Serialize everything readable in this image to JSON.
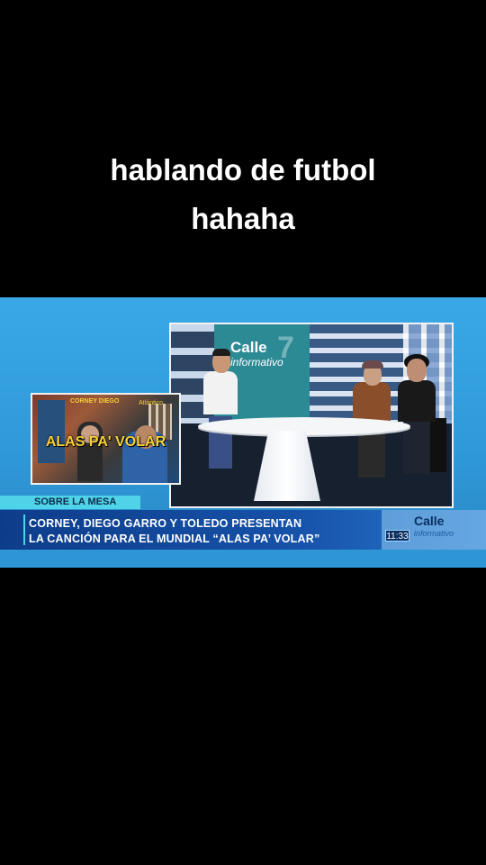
{
  "caption": {
    "line1": "hablando de futbol",
    "line2": "hahaha"
  },
  "broadcast": {
    "studio_logo": {
      "name": "Calle",
      "sub": "informativo",
      "number": "7"
    },
    "inset": {
      "title": "ALAS PA' VOLAR",
      "tag_left": "CORNEY DIEGO",
      "tag_right": "Atlántico"
    },
    "segment": "SOBRE LA MESA",
    "headline": {
      "line1": "CORNEY, DIEGO GARRO Y TOLEDO PRESENTAN",
      "line2": "LA CANCIÓN PARA EL MUNDIAL “ALAS PA’ VOLAR”"
    },
    "brand": {
      "name": "Calle",
      "sub": "informativo"
    },
    "time": "11:33"
  }
}
